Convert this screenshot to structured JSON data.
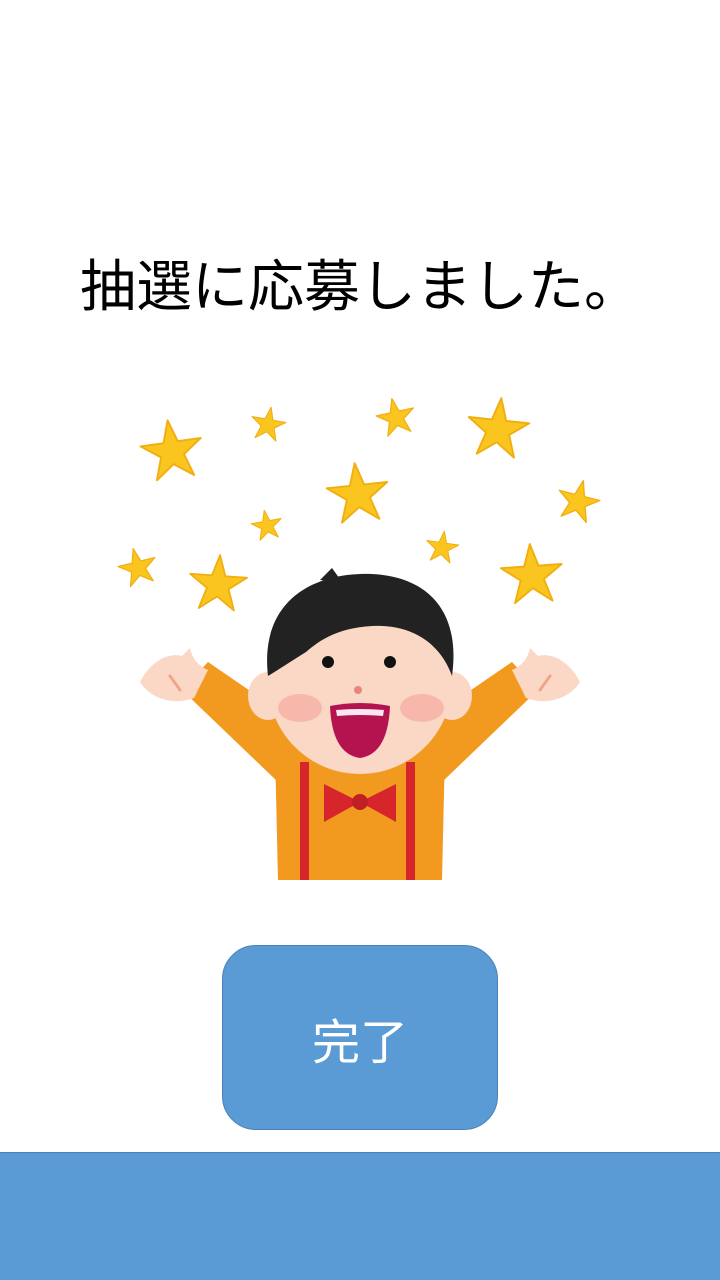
{
  "message": {
    "title": "抽選に応募しました。"
  },
  "illustration": {
    "icon": "celebrating-boy-with-stars-icon"
  },
  "actions": {
    "done_label": "完了"
  },
  "colors": {
    "accent": "#5b9bd5",
    "star": "#f9c51e",
    "shirt": "#f29a1f",
    "suspender": "#d7262b"
  }
}
